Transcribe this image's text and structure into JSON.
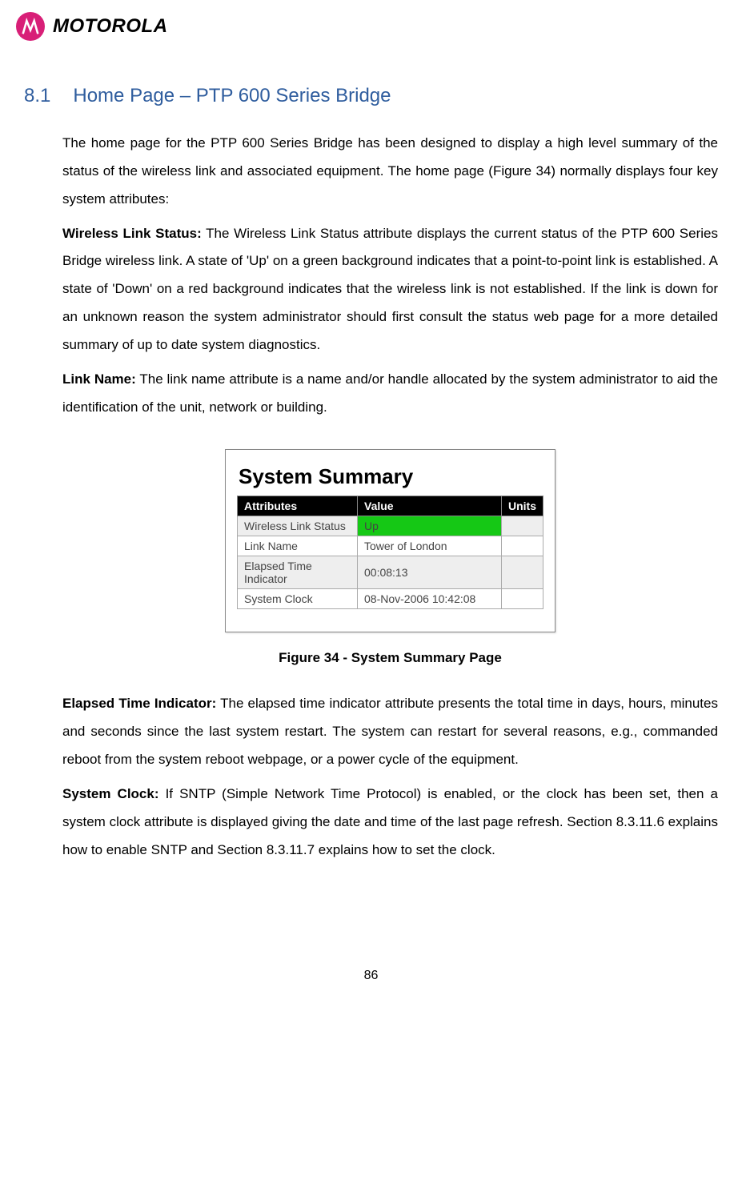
{
  "header": {
    "brand": "MOTOROLA"
  },
  "section": {
    "number": "8.1",
    "title": "Home Page – PTP 600 Series Bridge"
  },
  "paragraphs": {
    "intro": "The home page for the PTP 600 Series Bridge has been designed to display a high level summary of the status of the wireless link and associated equipment. The home page (Figure 34) normally displays four key system attributes:",
    "wireless_label": "Wireless Link Status:",
    "wireless_body": " The Wireless Link Status attribute displays the current status of the PTP 600 Series Bridge wireless link. A state of 'Up' on a green background indicates that a point-to-point link is established. A state of 'Down' on a red background indicates that the wireless link is not established. If the link is down for an unknown reason the system administrator should first consult the status web page for a more detailed summary of up to date system diagnostics.",
    "linkname_label": "Link Name:",
    "linkname_body": " The link name attribute is a name and/or handle allocated by the system administrator to aid the identification of the unit, network or building.",
    "elapsed_label": "Elapsed Time Indicator:",
    "elapsed_body": " The elapsed time indicator attribute presents the total time in days, hours, minutes and seconds since the last system restart. The system can restart for several reasons, e.g., commanded reboot from the system reboot webpage, or a power cycle of the equipment.",
    "clock_label": "System Clock:",
    "clock_body": " If SNTP (Simple Network Time Protocol) is enabled, or the clock has been set, then a system clock attribute is displayed giving the date and time of the last page refresh. Section 8.3.11.6 explains how to enable SNTP and Section 8.3.11.7 explains how to set the clock."
  },
  "figure": {
    "table_title": "System Summary",
    "headers": {
      "attr": "Attributes",
      "value": "Value",
      "units": "Units"
    },
    "rows": [
      {
        "attr": "Wireless Link Status",
        "value": "Up",
        "units": "",
        "green": true,
        "grey": true
      },
      {
        "attr": "Link Name",
        "value": "Tower of London",
        "units": "",
        "green": false,
        "grey": false
      },
      {
        "attr": "Elapsed Time Indicator",
        "value": "00:08:13",
        "units": "",
        "green": false,
        "grey": true
      },
      {
        "attr": "System Clock",
        "value": "08-Nov-2006 10:42:08",
        "units": "",
        "green": false,
        "grey": false
      }
    ],
    "caption": "Figure 34 - System Summary Page"
  },
  "page_number": "86"
}
